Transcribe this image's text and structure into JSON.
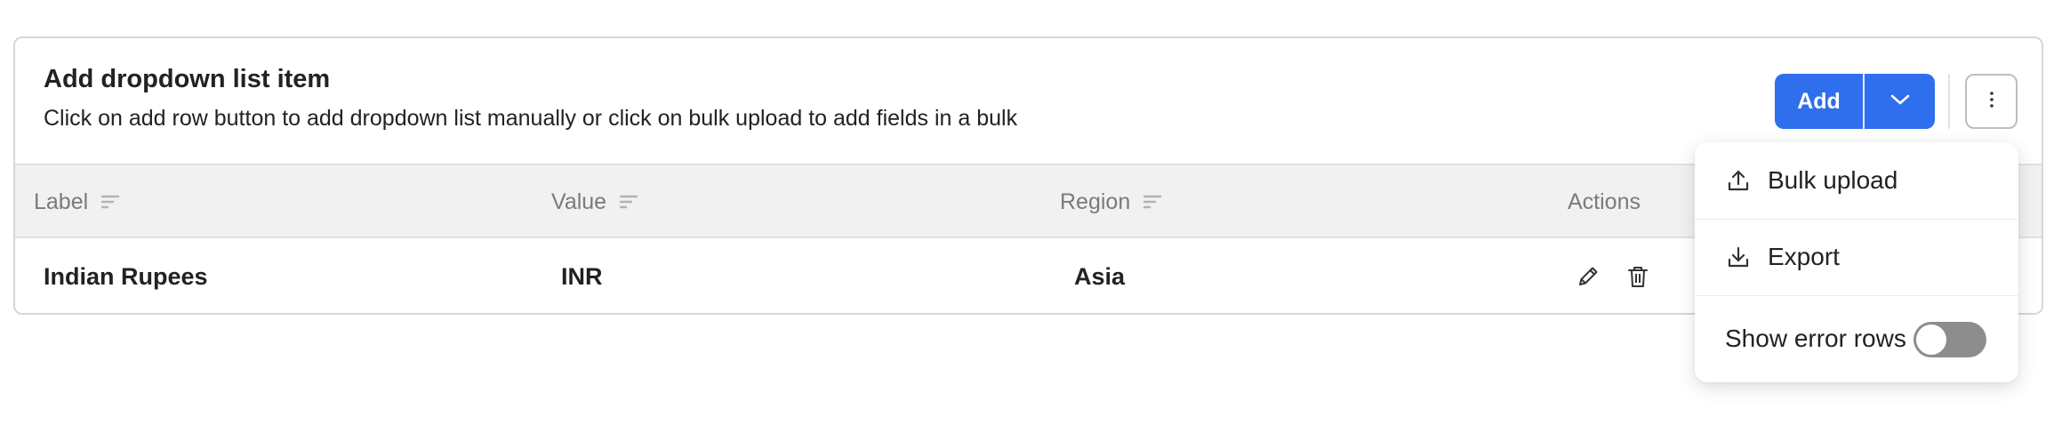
{
  "header": {
    "title": "Add dropdown list item",
    "subtitle": "Click on add row button to add dropdown list manually or click on bulk upload to add fields in a bulk"
  },
  "toolbar": {
    "add_label": "Add",
    "caret_icon": "chevron-down-icon",
    "more_icon": "kebab-menu-icon",
    "accent_color": "#2f6fed"
  },
  "table": {
    "columns": [
      {
        "label": "Label",
        "sortable": true
      },
      {
        "label": "Value",
        "sortable": true
      },
      {
        "label": "Region",
        "sortable": true
      },
      {
        "label": "Actions",
        "sortable": false
      }
    ],
    "rows": [
      {
        "label": "Indian Rupees",
        "value": "INR",
        "region": "Asia",
        "actions": [
          "edit-icon",
          "delete-icon"
        ]
      }
    ]
  },
  "menu": {
    "items": [
      {
        "label": "Bulk upload",
        "icon": "upload-icon"
      },
      {
        "label": "Export",
        "icon": "download-icon"
      }
    ],
    "toggle": {
      "label": "Show error rows",
      "checked": false,
      "off_color": "#8d8d8d"
    }
  }
}
